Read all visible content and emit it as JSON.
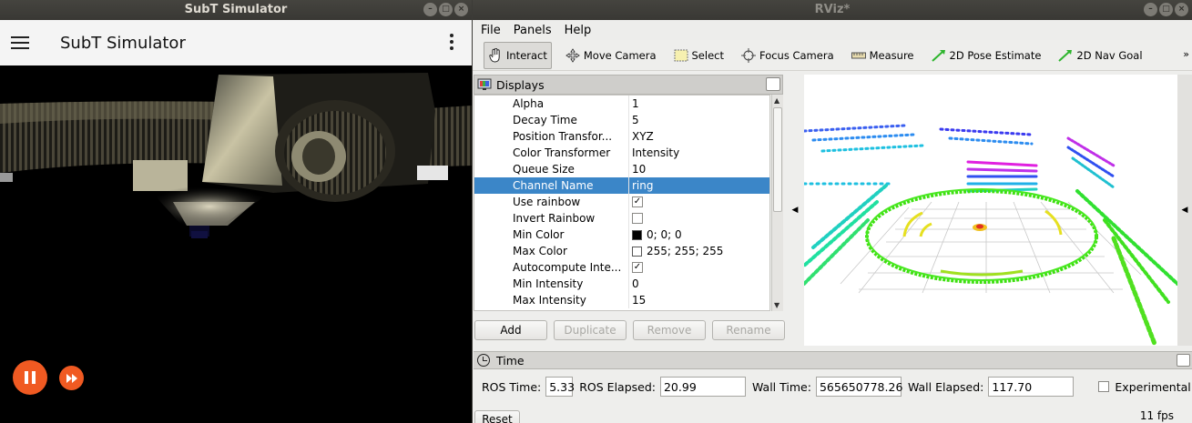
{
  "subt": {
    "window_title": "SubT Simulator",
    "app_title": "SubT Simulator",
    "pause_icon": "pause-icon",
    "fast_forward_icon": "fast-forward-icon",
    "accent": "#f05a22"
  },
  "rviz": {
    "window_title": "RViz*",
    "menu": [
      "File",
      "Panels",
      "Help"
    ],
    "tools": [
      {
        "label": "Interact",
        "icon": "hand-icon",
        "active": true
      },
      {
        "label": "Move Camera",
        "icon": "move-camera-icon"
      },
      {
        "label": "Select",
        "icon": "select-icon"
      },
      {
        "label": "Focus Camera",
        "icon": "focus-camera-icon"
      },
      {
        "label": "Measure",
        "icon": "ruler-icon"
      },
      {
        "label": "2D Pose Estimate",
        "icon": "green-arrow-icon"
      },
      {
        "label": "2D Nav Goal",
        "icon": "green-arrow-icon"
      }
    ],
    "displays": {
      "title": "Displays",
      "properties": [
        {
          "name": "Alpha",
          "value": "1"
        },
        {
          "name": "Decay Time",
          "value": "5"
        },
        {
          "name": "Position Transfor...",
          "value": "XYZ"
        },
        {
          "name": "Color Transformer",
          "value": "Intensity"
        },
        {
          "name": "Queue Size",
          "value": "10"
        },
        {
          "name": "Channel Name",
          "value": "ring",
          "selected": true
        },
        {
          "name": "Use rainbow",
          "checkbox": true,
          "checked": true
        },
        {
          "name": "Invert Rainbow",
          "checkbox": true,
          "checked": false
        },
        {
          "name": "Min Color",
          "value": "0; 0; 0",
          "swatch": "#000000"
        },
        {
          "name": "Max Color",
          "value": "255; 255; 255",
          "swatch": "#ffffff"
        },
        {
          "name": "Autocompute Inte...",
          "checkbox": true,
          "checked": true
        },
        {
          "name": "Min Intensity",
          "value": "0"
        },
        {
          "name": "Max Intensity",
          "value": "15"
        }
      ],
      "buttons": {
        "add": "Add",
        "duplicate": "Duplicate",
        "remove": "Remove",
        "rename": "Rename"
      }
    },
    "time": {
      "title": "Time",
      "ros_time_label": "ROS Time:",
      "ros_time": "5.33",
      "ros_elapsed_label": "ROS Elapsed:",
      "ros_elapsed": "20.99",
      "wall_time_label": "Wall Time:",
      "wall_time": "565650778.26",
      "wall_elapsed_label": "Wall Elapsed:",
      "wall_elapsed": "117.70",
      "experimental_label": "Experimental",
      "experimental_checked": false,
      "reset": "Reset",
      "fps": "11 fps"
    },
    "selection_color": "#3b86c8"
  }
}
